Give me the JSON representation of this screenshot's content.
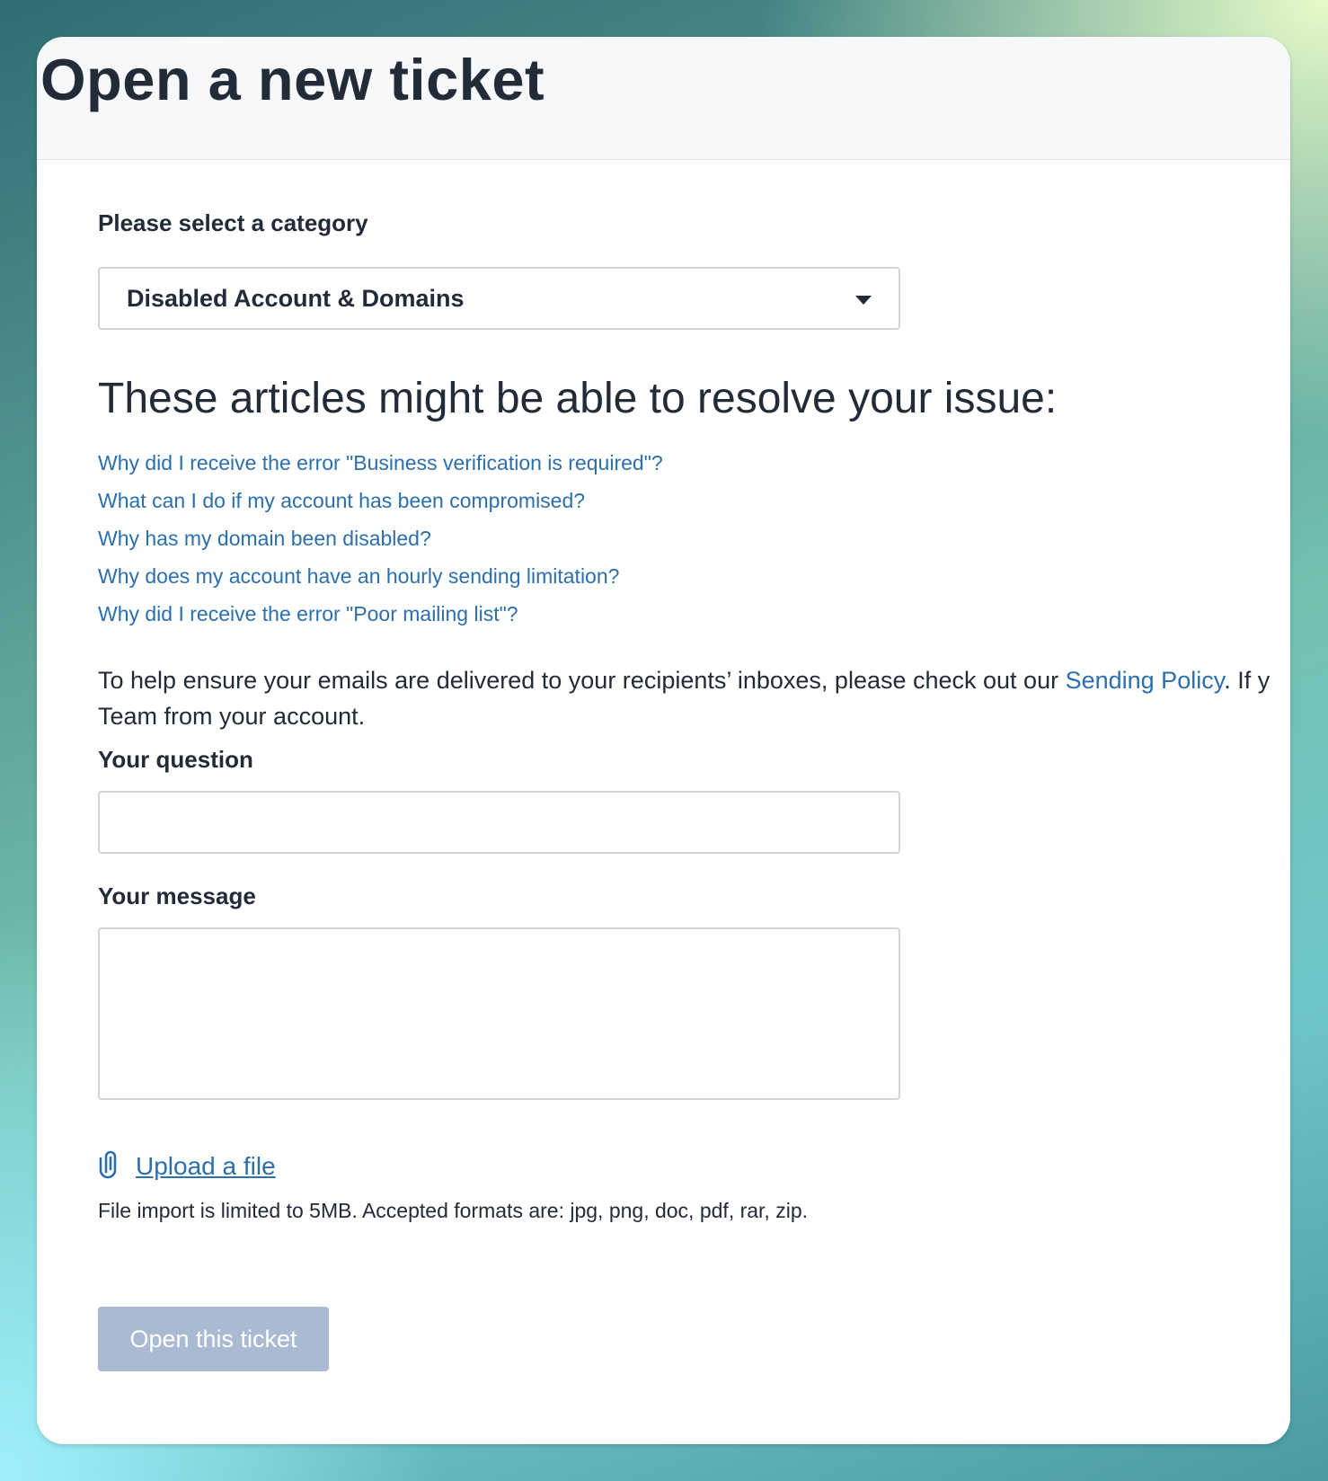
{
  "page": {
    "title": "Open a new ticket"
  },
  "category": {
    "label": "Please select a category",
    "selected": "Disabled Account & Domains"
  },
  "articles": {
    "heading": "These articles might be able to resolve your issue:",
    "items": [
      "Why did I receive the error \"Business verification is required\"?",
      "What can I do if my account has been compromised?",
      "Why has my domain been disabled?",
      "Why does my account have an hourly sending limitation?",
      "Why did I receive the error \"Poor mailing list\"?"
    ]
  },
  "info": {
    "text_before": "To help ensure your emails are delivered to your recipients’ inboxes, please check out our ",
    "link": "Sending Policy",
    "text_after": ". If y",
    "line2": "Team from your account."
  },
  "question": {
    "label": "Your question",
    "value": ""
  },
  "message": {
    "label": "Your message",
    "value": ""
  },
  "upload": {
    "icon": "paperclip-icon",
    "link": "Upload a file",
    "hint": "File import is limited to 5MB. Accepted formats are: jpg, png, doc, pdf, rar, zip."
  },
  "submit": {
    "label": "Open this ticket",
    "state": "disabled"
  },
  "colors": {
    "link": "#2c6fae",
    "text": "#222b38",
    "button_disabled": "#a9bad2"
  }
}
